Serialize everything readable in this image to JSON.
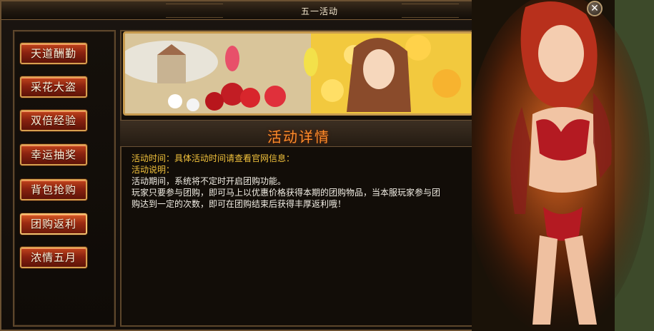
{
  "window": {
    "title": "五一活动"
  },
  "menu": {
    "items": [
      {
        "label": "天道酬勤"
      },
      {
        "label": "采花大盗"
      },
      {
        "label": "双倍经验"
      },
      {
        "label": "幸运抽奖"
      },
      {
        "label": "背包抢购"
      },
      {
        "label": "团购返利"
      },
      {
        "label": "浓情五月"
      }
    ],
    "active_index": 5
  },
  "detail": {
    "header": "活动详情",
    "time_line": "活动时间：具体活动时间请查看官网信息：",
    "desc_label": "活动说明：",
    "line1": "活动期间，系统将不定时开启团购功能。",
    "line2": "玩家只要参与团购，即可马上以优惠价格获得本期的团购物品，当本服玩家参与团",
    "line3": "购达到一定的次数，即可在团购结束后获得丰厚返利哦！"
  },
  "colors": {
    "accent_orange": "#ff8c2a",
    "gold_text": "#f2c23c",
    "button_red": "#8a2210"
  },
  "icons": {
    "close": "close-icon"
  }
}
